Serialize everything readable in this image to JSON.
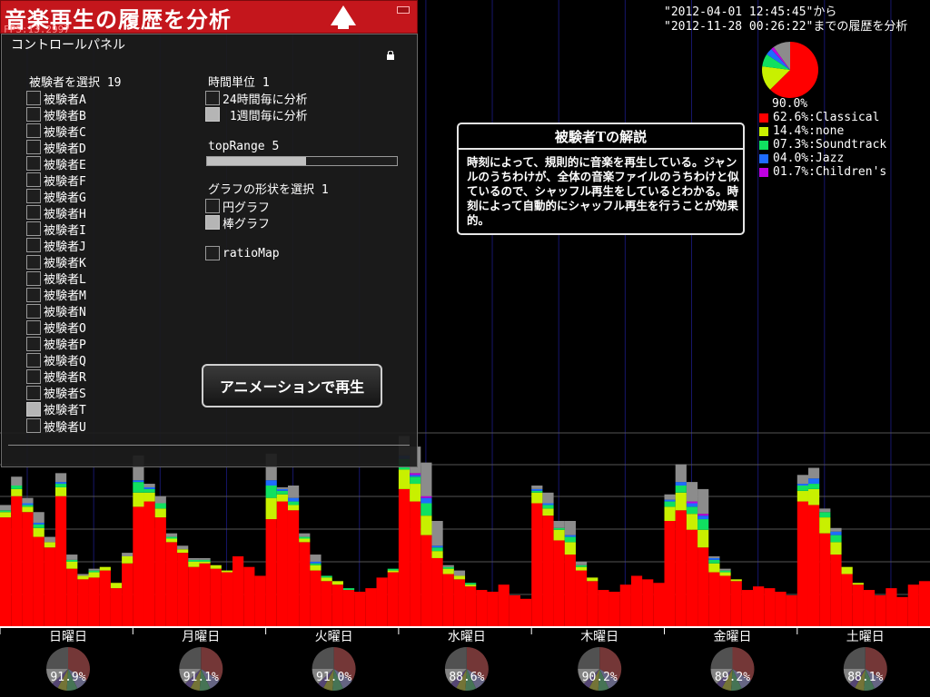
{
  "app": {
    "title": "音楽再生の履歴を分析",
    "fps": "FPS:13.2997"
  },
  "colors": {
    "classical": "#ff0000",
    "none": "#c8f000",
    "soundtrack": "#10e060",
    "jazz": "#1e6cff",
    "childrens": "#c000e0",
    "other": "#8c8c8c",
    "title_bar": "#c4161c"
  },
  "control_panel": {
    "title": "コントロールパネル",
    "subject_select_label": "被験者を選択 19",
    "subjects": [
      {
        "label": "被験者A",
        "checked": false
      },
      {
        "label": "被験者B",
        "checked": false
      },
      {
        "label": "被験者C",
        "checked": false
      },
      {
        "label": "被験者D",
        "checked": false
      },
      {
        "label": "被験者E",
        "checked": false
      },
      {
        "label": "被験者F",
        "checked": false
      },
      {
        "label": "被験者G",
        "checked": false
      },
      {
        "label": "被験者H",
        "checked": false
      },
      {
        "label": "被験者I",
        "checked": false
      },
      {
        "label": "被験者J",
        "checked": false
      },
      {
        "label": "被験者K",
        "checked": false
      },
      {
        "label": "被験者L",
        "checked": false
      },
      {
        "label": "被験者M",
        "checked": false
      },
      {
        "label": "被験者N",
        "checked": false
      },
      {
        "label": "被験者O",
        "checked": false
      },
      {
        "label": "被験者P",
        "checked": false
      },
      {
        "label": "被験者Q",
        "checked": false
      },
      {
        "label": "被験者R",
        "checked": false
      },
      {
        "label": "被験者S",
        "checked": false
      },
      {
        "label": "被験者T",
        "checked": true
      },
      {
        "label": "被験者U",
        "checked": false
      }
    ],
    "time_unit_label": "時間単位 1",
    "time_units": [
      {
        "label": "24時間毎に分析",
        "checked": false
      },
      {
        "label": " 1週間毎に分析",
        "checked": true
      }
    ],
    "top_range_label": "topRange 5",
    "top_range_fraction": 0.52,
    "graph_shape_label": "グラフの形状を選択 1",
    "graph_shapes": [
      {
        "label": "円グラフ",
        "checked": false
      },
      {
        "label": "棒グラフ",
        "checked": true
      }
    ],
    "ratio_map": {
      "label": "ratioMap",
      "checked": false
    },
    "animate_button": "アニメーションで再生",
    "icons": {
      "lock": "lock-icon",
      "logo": "triangle-logo-icon"
    }
  },
  "date_range": {
    "line1": "\"2012-04-01 12:45:45\"から",
    "line2": "\"2012-11-28 00:26:22\"までの履歴を分析"
  },
  "explanation": {
    "title": "被験者Tの解説",
    "body": "時刻によって、規則的に音楽を再生している。ジャンルのうちわけが、全体の音楽ファイルのうちわけと似ているので、シャッフル再生をしているとわかる。時刻によって自動的にシャッフル再生を行うことが効果的。"
  },
  "legend": {
    "percent": "90.0%",
    "items": [
      {
        "text": "62.6%:Classical",
        "color": "#ff0000"
      },
      {
        "text": "14.4%:none",
        "color": "#c8f000"
      },
      {
        "text": "07.3%:Soundtrack",
        "color": "#10e060"
      },
      {
        "text": "04.0%:Jazz",
        "color": "#1e6cff"
      },
      {
        "text": "01.7%:Children's",
        "color": "#c000e0"
      }
    ]
  },
  "chart_data": {
    "type": "bar",
    "stacked": true,
    "grid": true,
    "days": [
      "日曜日",
      "月曜日",
      "火曜日",
      "水曜日",
      "木曜日",
      "金曜日",
      "土曜日"
    ],
    "day_percents": [
      "91.9%",
      "91.1%",
      "91.0%",
      "88.6%",
      "90.2%",
      "89.2%",
      "88.1%"
    ],
    "stack_order": [
      "Classical",
      "none",
      "Soundtrack",
      "Jazz",
      "Children's",
      "other"
    ],
    "series_colors": [
      "#ff0000",
      "#c8f000",
      "#10e060",
      "#1e6cff",
      "#c000e0",
      "#8c8c8c"
    ],
    "overall_pie": [
      62.6,
      14.4,
      7.3,
      4.0,
      1.7,
      10.0
    ],
    "bars": [
      [
        62,
        3,
        1,
        0,
        0,
        3
      ],
      [
        74,
        4,
        2,
        0,
        0,
        5
      ],
      [
        65,
        3,
        1,
        1,
        0,
        3
      ],
      [
        51,
        5,
        2,
        1,
        0,
        6
      ],
      [
        45,
        3,
        0,
        0,
        0,
        3
      ],
      [
        74,
        5,
        2,
        1,
        0,
        5
      ],
      [
        33,
        4,
        1,
        0,
        0,
        3
      ],
      [
        27,
        2,
        0,
        0,
        0,
        1
      ],
      [
        28,
        3,
        1,
        0,
        0,
        1
      ],
      [
        32,
        2,
        0,
        0,
        0,
        0
      ],
      [
        22,
        3,
        0,
        0,
        0,
        0
      ],
      [
        36,
        4,
        0,
        0,
        0,
        2
      ],
      [
        68,
        8,
        6,
        1,
        0,
        14
      ],
      [
        71,
        5,
        2,
        1,
        0,
        2
      ],
      [
        62,
        5,
        3,
        0,
        0,
        4
      ],
      [
        48,
        2,
        1,
        0,
        0,
        2
      ],
      [
        42,
        2,
        0,
        0,
        0,
        2
      ],
      [
        34,
        3,
        1,
        0,
        0,
        1
      ],
      [
        36,
        1,
        1,
        0,
        0,
        1
      ],
      [
        33,
        2,
        0,
        0,
        0,
        0
      ],
      [
        31,
        1,
        0,
        0,
        0,
        0
      ],
      [
        40,
        0,
        0,
        0,
        0,
        0
      ],
      [
        34,
        0,
        0,
        0,
        0,
        0
      ],
      [
        29,
        0,
        0,
        0,
        0,
        0
      ],
      [
        61,
        12,
        7,
        3,
        0,
        15
      ],
      [
        71,
        4,
        2,
        1,
        0,
        1
      ],
      [
        66,
        3,
        2,
        2,
        0,
        7
      ],
      [
        48,
        2,
        1,
        0,
        0,
        2
      ],
      [
        32,
        3,
        1,
        1,
        0,
        4
      ],
      [
        26,
        2,
        1,
        0,
        0,
        0
      ],
      [
        24,
        2,
        0,
        0,
        0,
        0
      ],
      [
        21,
        0,
        1,
        0,
        0,
        0
      ],
      [
        20,
        0,
        0,
        0,
        0,
        0
      ],
      [
        22,
        0,
        0,
        0,
        0,
        0
      ],
      [
        28,
        0,
        0,
        0,
        0,
        0
      ],
      [
        31,
        1,
        1,
        0,
        0,
        0
      ],
      [
        78,
        11,
        6,
        2,
        0,
        11
      ],
      [
        71,
        10,
        4,
        1,
        1,
        15
      ],
      [
        52,
        11,
        7,
        3,
        1,
        19
      ],
      [
        39,
        4,
        2,
        1,
        0,
        14
      ],
      [
        30,
        3,
        1,
        0,
        0,
        1
      ],
      [
        27,
        2,
        0,
        0,
        0,
        3
      ],
      [
        23,
        1,
        1,
        0,
        0,
        0
      ],
      [
        21,
        0,
        0,
        0,
        0,
        0
      ],
      [
        20,
        0,
        0,
        0,
        0,
        0
      ],
      [
        24,
        0,
        0,
        0,
        0,
        0
      ],
      [
        18,
        0,
        0,
        0,
        0,
        0
      ],
      [
        16,
        0,
        0,
        0,
        0,
        0
      ],
      [
        70,
        6,
        1,
        1,
        0,
        2
      ],
      [
        63,
        4,
        2,
        1,
        0,
        6
      ],
      [
        49,
        6,
        1,
        0,
        0,
        4
      ],
      [
        41,
        7,
        3,
        1,
        0,
        8
      ],
      [
        32,
        2,
        1,
        0,
        0,
        2
      ],
      [
        26,
        2,
        0,
        0,
        0,
        0
      ],
      [
        21,
        0,
        0,
        0,
        0,
        0
      ],
      [
        20,
        0,
        0,
        0,
        0,
        0
      ],
      [
        24,
        0,
        0,
        0,
        0,
        0
      ],
      [
        29,
        0,
        0,
        0,
        0,
        0
      ],
      [
        27,
        0,
        0,
        0,
        0,
        0
      ],
      [
        25,
        0,
        0,
        0,
        0,
        0
      ],
      [
        60,
        8,
        3,
        1,
        0,
        3
      ],
      [
        66,
        10,
        4,
        2,
        0,
        10
      ],
      [
        55,
        9,
        4,
        2,
        1,
        11
      ],
      [
        45,
        10,
        6,
        2,
        1,
        14
      ],
      [
        31,
        5,
        2,
        1,
        0,
        1
      ],
      [
        29,
        2,
        1,
        0,
        0,
        1
      ],
      [
        26,
        1,
        0,
        0,
        0,
        0
      ],
      [
        21,
        0,
        0,
        0,
        0,
        0
      ],
      [
        23,
        0,
        0,
        0,
        0,
        0
      ],
      [
        22,
        0,
        0,
        0,
        0,
        0
      ],
      [
        20,
        0,
        0,
        0,
        0,
        0
      ],
      [
        18,
        0,
        0,
        0,
        0,
        0
      ],
      [
        71,
        6,
        3,
        1,
        0,
        5
      ],
      [
        69,
        9,
        3,
        3,
        0,
        6
      ],
      [
        53,
        9,
        3,
        0,
        0,
        2
      ],
      [
        41,
        7,
        4,
        2,
        0,
        2
      ],
      [
        30,
        4,
        0,
        0,
        0,
        0
      ],
      [
        24,
        1,
        0,
        0,
        0,
        0
      ],
      [
        21,
        0,
        0,
        0,
        0,
        0
      ],
      [
        18,
        0,
        0,
        0,
        0,
        0
      ],
      [
        22,
        0,
        0,
        0,
        0,
        0
      ],
      [
        17,
        0,
        0,
        0,
        0,
        0
      ],
      [
        24,
        0,
        0,
        0,
        0,
        0
      ],
      [
        26,
        0,
        0,
        0,
        0,
        0
      ]
    ]
  }
}
